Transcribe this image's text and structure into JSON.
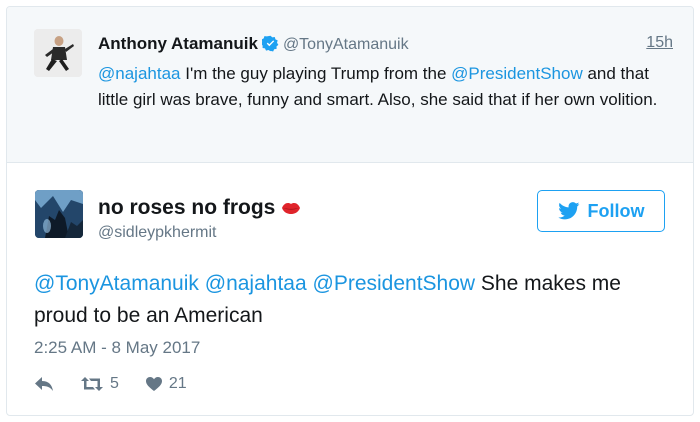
{
  "parent_tweet": {
    "name": "Anthony Atamanuik",
    "handle": "@TonyAtamanuik",
    "time": "15h",
    "text": {
      "mention1": "@najahtaa",
      "part1": " I'm the guy playing Trump from the ",
      "mention2": "@PresidentShow",
      "part2": " and that little girl was brave, funny and smart. Also, she said that if her own volition."
    }
  },
  "main_tweet": {
    "name": "no roses no frogs",
    "handle": "@sidleypkhermit",
    "follow_label": "Follow",
    "text": {
      "mention1": "@TonyAtamanuik",
      "mention2": "@najahtaa",
      "mention3": "@PresidentShow",
      "part": " She makes me proud to be an American"
    },
    "timestamp": "2:25 AM - 8 May 2017",
    "retweet_count": "5",
    "like_count": "21"
  },
  "icons": [
    "verified-badge-icon",
    "lips-emoji-icon",
    "twitter-bird-icon",
    "reply-icon",
    "retweet-icon",
    "heart-icon"
  ],
  "colors": {
    "link": "#1b95e0",
    "accent": "#1da1f2",
    "muted": "#657786",
    "lips": "#e0242b"
  }
}
